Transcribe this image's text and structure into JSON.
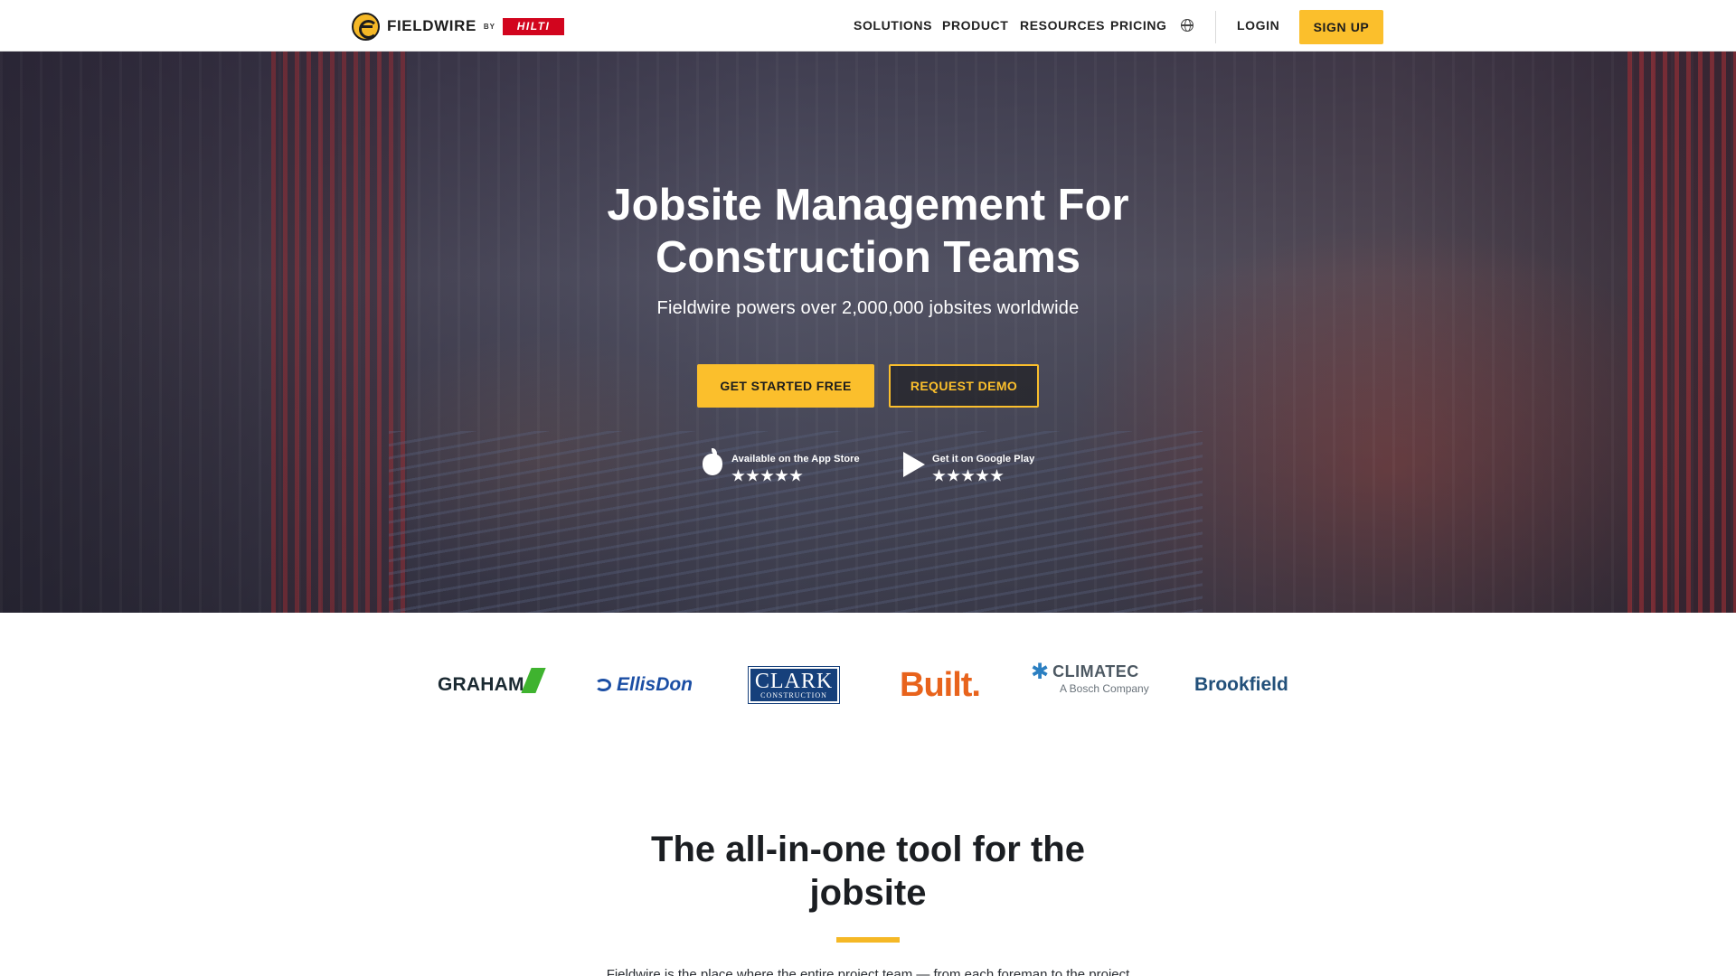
{
  "brand": {
    "name": "FIELDWIRE",
    "by": "BY",
    "partner": "HILTI"
  },
  "nav": {
    "items": [
      "SOLUTIONS",
      "PRODUCT",
      "RESOURCES",
      "PRICING"
    ],
    "login": "LOGIN",
    "signup": "SIGN UP"
  },
  "hero": {
    "title_line1": "Jobsite Management For",
    "title_line2": "Construction Teams",
    "subtitle": "Fieldwire powers over 2,000,000 jobsites worldwide",
    "cta_primary": "GET STARTED FREE",
    "cta_secondary": "REQUEST DEMO",
    "app_store": {
      "label": "Available on the App Store",
      "rating": 5
    },
    "google_play": {
      "label": "Get it on Google Play",
      "rating": 5
    }
  },
  "logos": {
    "graham": "GRAHAM",
    "ellisdon": "EllisDon",
    "clark": "CLARK",
    "clark_sub": "CONSTRUCTION",
    "built": "Built.",
    "climatec": "CLIMATEC",
    "climatec_sub": "A Bosch Company",
    "brookfield": "Brookfield"
  },
  "section": {
    "title_line1": "The all-in-one tool for the",
    "title_line2": "jobsite",
    "intro": "Fieldwire is the place where the entire project team — from each foreman to the project"
  },
  "colors": {
    "accent": "#fbbf2c",
    "hilti_red": "#d2051e",
    "text_dark": "#1b1e22"
  }
}
